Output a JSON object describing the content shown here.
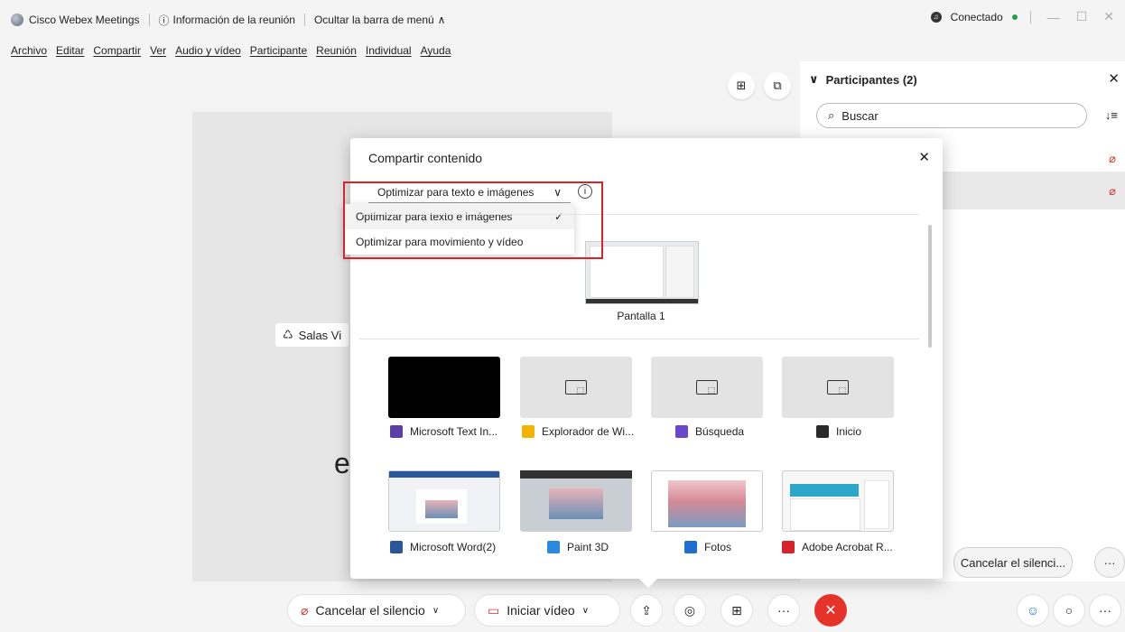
{
  "titlebar": {
    "app_name": "Cisco Webex Meetings",
    "meeting_info": "Información de la reunión",
    "hide_menu": "Ocultar la barra de menú",
    "status": "Conectado"
  },
  "menubar": [
    "Archivo",
    "Editar",
    "Compartir",
    "Ver",
    "Audio y vídeo",
    "Participante",
    "Reunión",
    "Individual",
    "Ayuda"
  ],
  "stage": {
    "breakout_label": "Salas Vi",
    "participant_name": "e"
  },
  "panel": {
    "title": "Participantes (2)",
    "search_placeholder": "Buscar",
    "bottom_button": "Cancelar el silenci..."
  },
  "share_dialog": {
    "title": "Compartir contenido",
    "optimize_selected": "Optimizar para texto e imágenes",
    "options": [
      {
        "label": "Optimizar para texto e imágenes",
        "selected": true
      },
      {
        "label": "Optimizar para movimiento y vídeo",
        "selected": false
      }
    ],
    "screen_label": "Pantalla 1",
    "apps_row1": [
      {
        "label": "Microsoft Text In...",
        "color": "#5b3fa6"
      },
      {
        "label": "Explorador de Wi...",
        "color": "#f2b400"
      },
      {
        "label": "Búsqueda",
        "color": "#6b48c8"
      },
      {
        "label": "Inicio",
        "color": "#2a2a2a"
      }
    ],
    "apps_row2": [
      {
        "label": "Microsoft Word(2)",
        "color": "#2b579a"
      },
      {
        "label": "Paint 3D",
        "color": "#2a8adf"
      },
      {
        "label": "Fotos",
        "color": "#1f6fd1"
      },
      {
        "label": "Adobe Acrobat R...",
        "color": "#d4232a"
      }
    ]
  },
  "toolbar": {
    "mute": "Cancelar el silencio",
    "video": "Iniciar vídeo"
  },
  "colors": {
    "accent_red": "#e5332a",
    "highlight_border": "#d6252a",
    "status_green": "#1ea34a"
  }
}
